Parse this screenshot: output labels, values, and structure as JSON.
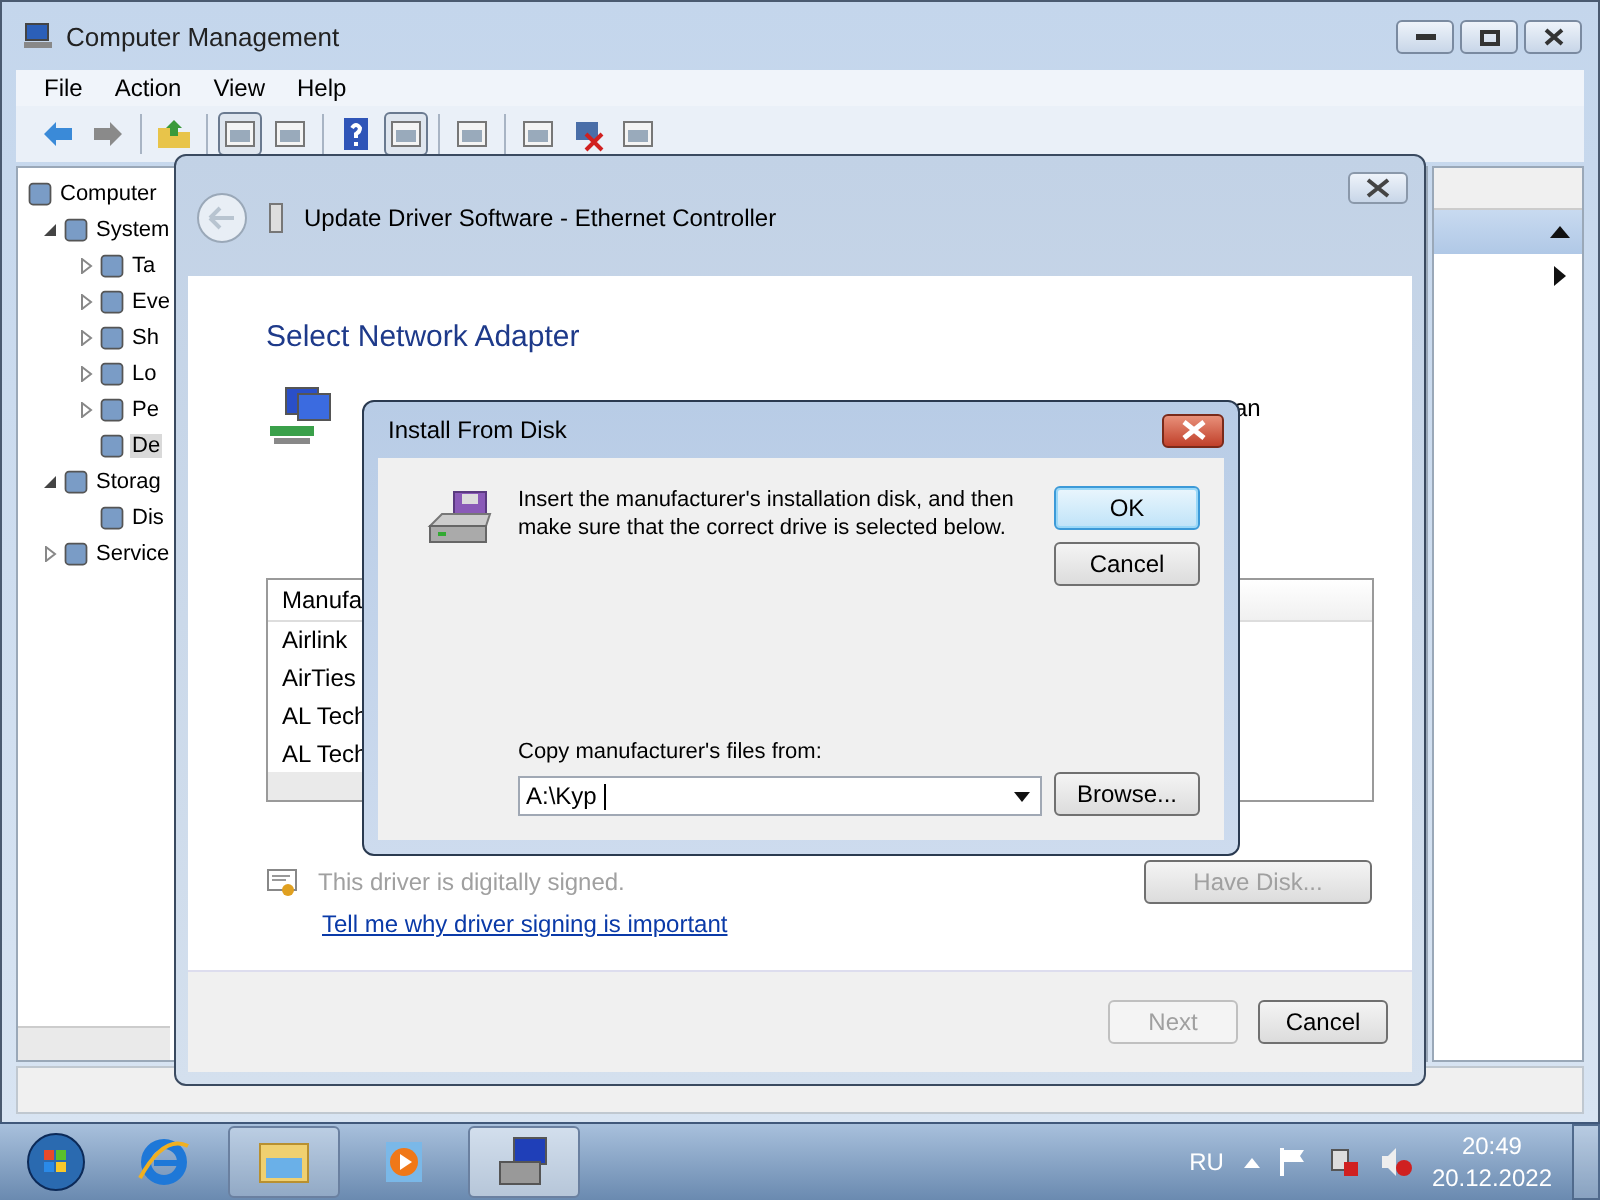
{
  "main_window": {
    "title": "Computer Management",
    "menu": [
      "File",
      "Action",
      "View",
      "Help"
    ],
    "toolbar": [
      {
        "pressed": false
      },
      {
        "pressed": false
      },
      {
        "pressed": false
      },
      {
        "pressed": true
      },
      {
        "pressed": false
      },
      {
        "pressed": false
      },
      {
        "pressed": true
      },
      {
        "pressed": false
      },
      {
        "pressed": false
      },
      {
        "pressed": false
      },
      {
        "pressed": false
      }
    ],
    "tree": [
      {
        "label": "Computer",
        "selected": false,
        "children": [
          {
            "label": "System",
            "expanded": true,
            "selected": false,
            "children": [
              {
                "label": "Ta",
                "expanded": false,
                "selected": false
              },
              {
                "label": "Eve",
                "expanded": false,
                "selected": false
              },
              {
                "label": "Sh",
                "expanded": false,
                "selected": false
              },
              {
                "label": "Lo",
                "expanded": false,
                "selected": false
              },
              {
                "label": "Pe",
                "expanded": false,
                "selected": false
              },
              {
                "label": "De",
                "selected": true
              }
            ]
          },
          {
            "label": "Storag",
            "expanded": true,
            "selected": false,
            "children": [
              {
                "label": "Dis",
                "selected": false
              }
            ]
          },
          {
            "label": "Service",
            "expanded": false,
            "selected": false
          }
        ]
      }
    ]
  },
  "wizard": {
    "title": "Update Driver Software - Ethernet Controller",
    "heading": "Select Network Adapter",
    "partial_text": "an",
    "list": {
      "column": "Manufa",
      "rows": [
        "Airlink",
        "AirTies",
        "AL Tech",
        "AL Tech"
      ]
    },
    "signed_text": "This driver is digitally signed.",
    "link": "Tell me why driver signing is important",
    "have_disk": "Have Disk...",
    "buttons": [
      {
        "label": "Next",
        "disabled": true
      },
      {
        "label": "Cancel",
        "disabled": false
      }
    ]
  },
  "dialog": {
    "title": "Install From Disk",
    "message": "Insert the manufacturer's installation disk, and then make sure that the correct drive is selected below.",
    "buttons": [
      {
        "label": "OK",
        "default": true
      },
      {
        "label": "Cancel",
        "default": false
      }
    ],
    "copy_label": "Copy manufacturer's files from:",
    "path": "A:\\Kyp ",
    "browse": "Browse..."
  },
  "taskbar": {
    "apps": [
      {
        "selected": false,
        "pinned": false
      },
      {
        "selected": false,
        "pinned": true
      },
      {
        "selected": false,
        "pinned": false
      },
      {
        "selected": true,
        "pinned": true
      }
    ],
    "language": "RU",
    "time": "20:49",
    "date": "20.12.2022"
  }
}
